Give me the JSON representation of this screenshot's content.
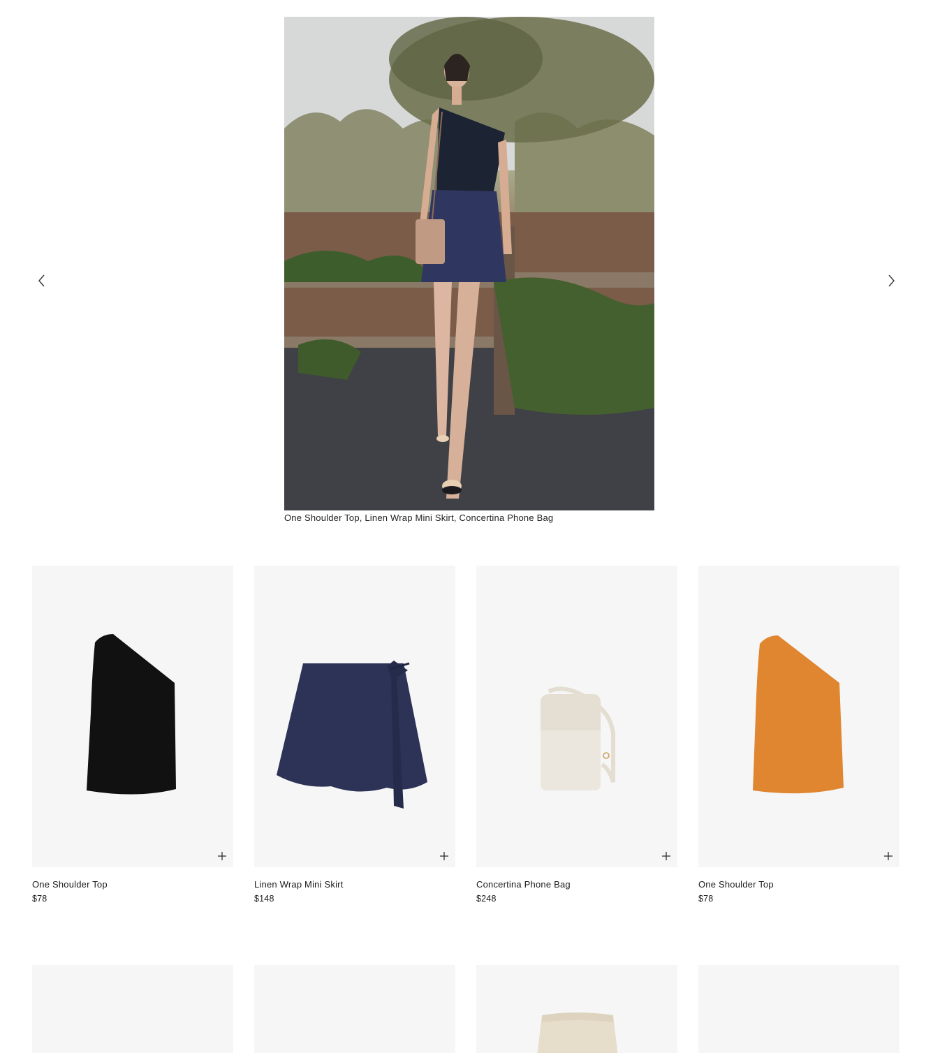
{
  "hero": {
    "caption": "One Shoulder Top, Linen Wrap Mini Skirt, Concertina Phone Bag",
    "image_alt": "Model in black one shoulder top, navy linen wrap mini skirt and tan phone bag standing under a tree"
  },
  "carousel": {
    "prev_icon": "chevron-left-icon",
    "next_icon": "chevron-right-icon"
  },
  "products": [
    {
      "name": "One Shoulder Top",
      "price": "$78",
      "color": "#111111"
    },
    {
      "name": "Linen Wrap Mini Skirt",
      "price": "$148",
      "color": "#2c3356"
    },
    {
      "name": "Concertina Phone Bag",
      "price": "$248",
      "color": "#ece7de"
    },
    {
      "name": "One Shoulder Top",
      "price": "$78",
      "color": "#e08530"
    }
  ],
  "add_icon": "plus-icon"
}
